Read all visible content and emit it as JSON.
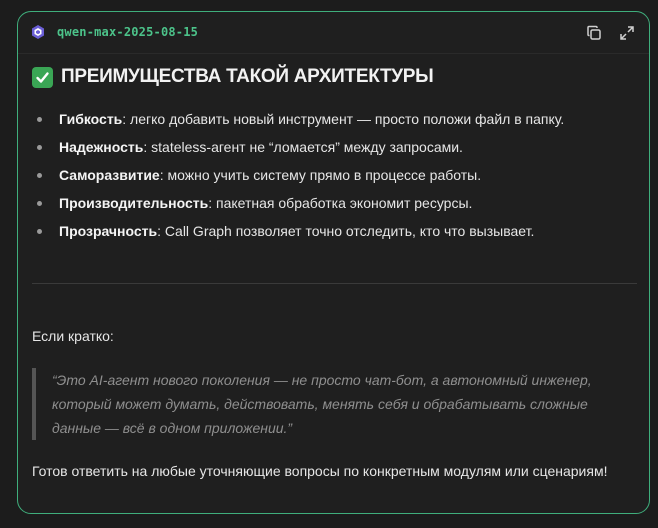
{
  "header": {
    "model_name": "qwen-max-2025-08-15",
    "model_icon": "qwen-logo-icon",
    "copy_icon": "copy-icon",
    "expand_icon": "expand-icon"
  },
  "heading": {
    "icon": "check-mark-icon",
    "text": "ПРЕИМУЩЕСТВА ТАКОЙ АРХИТЕКТУРЫ"
  },
  "advantages": [
    {
      "term": "Гибкость",
      "text": ": легко добавить новый инструмент — просто положи файл в папку."
    },
    {
      "term": "Надежность",
      "text": ": stateless-агент не “ломается” между запросами."
    },
    {
      "term": "Саморазвитие",
      "text": ": можно учить систему прямо в процессе работы."
    },
    {
      "term": "Производительность",
      "text": ": пакетная обработка экономит ресурсы."
    },
    {
      "term": "Прозрачность",
      "text": ": Call Graph позволяет точно отследить, кто что вызывает."
    }
  ],
  "intro": "Если кратко:",
  "quote": "“Это AI-агент нового поколения — не просто чат-бот, а автономный инженер, который может думать, действовать, менять себя и обрабатывать сложные данные — всё в одном приложении.”",
  "closing": "Готов ответить на любые уточняющие вопросы по конкретным модулям или сценариям!",
  "colors": {
    "accent": "#3fae7c",
    "model_name": "#4cc38a",
    "check": "#3aa655",
    "quote_text": "#8f8f8f"
  }
}
